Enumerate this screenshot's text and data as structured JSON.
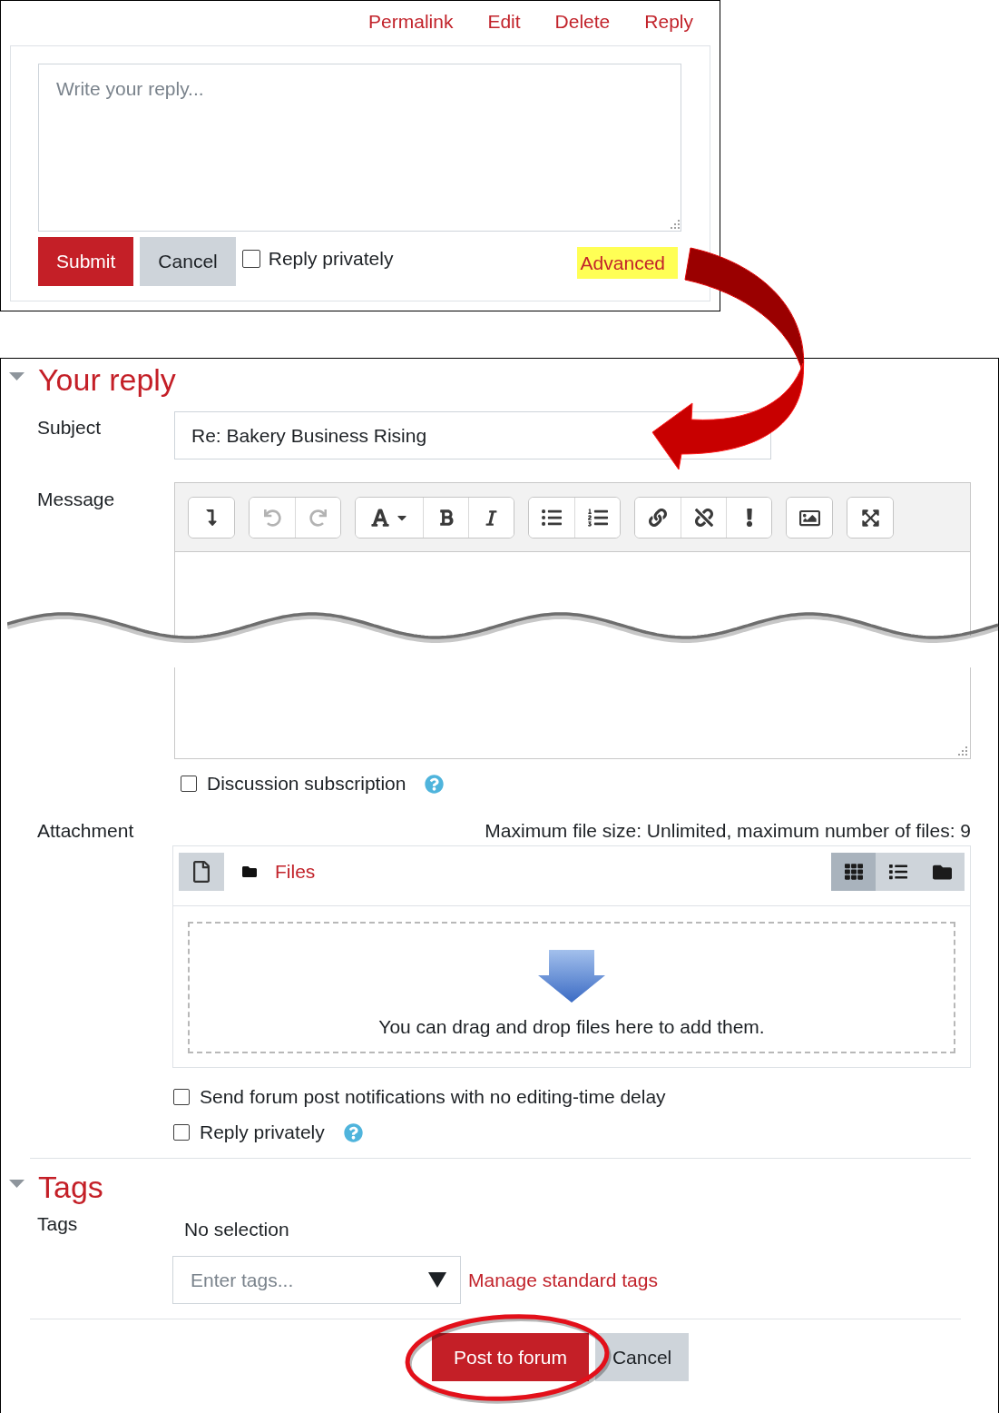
{
  "top_panel": {
    "links": [
      "Permalink",
      "Edit",
      "Delete",
      "Reply"
    ],
    "reply_field": {
      "placeholder": "Write your reply..."
    },
    "buttons": [
      {
        "label": "Submit",
        "kind": "primary"
      },
      {
        "label": "Cancel",
        "kind": "secondary"
      }
    ],
    "reply_privately": {
      "label": "Reply privately",
      "checked": false
    },
    "advanced": {
      "label": "Advanced",
      "highlighted": true
    }
  },
  "your_reply": {
    "heading": "Your reply",
    "expanded": true,
    "subject": {
      "label": "Subject",
      "value": "Re: Bakery Business Rising"
    },
    "message": {
      "label": "Message",
      "toolbar": [
        {
          "buttons": [
            {
              "kind": "more",
              "disabled": false
            }
          ]
        },
        {
          "buttons": [
            {
              "kind": "undo",
              "disabled": true
            },
            {
              "kind": "redo",
              "disabled": true
            }
          ]
        },
        {
          "buttons": [
            {
              "kind": "font",
              "disabled": false
            },
            {
              "kind": "bold",
              "disabled": false
            },
            {
              "kind": "italic",
              "disabled": false
            }
          ]
        },
        {
          "buttons": [
            {
              "kind": "bullets",
              "disabled": false
            },
            {
              "kind": "numbers",
              "disabled": false
            }
          ]
        },
        {
          "buttons": [
            {
              "kind": "link",
              "disabled": false
            },
            {
              "kind": "unlink",
              "disabled": false
            },
            {
              "kind": "warning",
              "disabled": false
            }
          ]
        },
        {
          "buttons": [
            {
              "kind": "image",
              "disabled": false
            }
          ]
        },
        {
          "buttons": [
            {
              "kind": "fullscreen",
              "disabled": false
            }
          ]
        }
      ]
    },
    "discussion_subscription": {
      "label": "Discussion subscription",
      "checked": false,
      "help": true
    },
    "attachment": {
      "label": "Attachment",
      "limits": "Maximum file size: Unlimited, maximum number of files: 9",
      "path": "Files",
      "views": [
        {
          "kind": "grid",
          "selected": true
        },
        {
          "kind": "list",
          "selected": false
        },
        {
          "kind": "tree",
          "selected": false
        }
      ],
      "drop_hint": "You can drag and drop files here to add them."
    },
    "options": [
      {
        "label": "Send forum post notifications with no editing-time delay",
        "checked": false,
        "help": false
      },
      {
        "label": "Reply privately",
        "checked": false,
        "help": true
      }
    ]
  },
  "tags": {
    "heading": "Tags",
    "expanded": true,
    "label": "Tags",
    "selection": "No selection",
    "input": {
      "placeholder": "Enter tags..."
    },
    "manage_link": "Manage standard tags"
  },
  "actions": [
    {
      "label": "Post to forum",
      "kind": "primary",
      "circled": true
    },
    {
      "label": "Cancel",
      "kind": "secondary",
      "circled": false
    }
  ]
}
